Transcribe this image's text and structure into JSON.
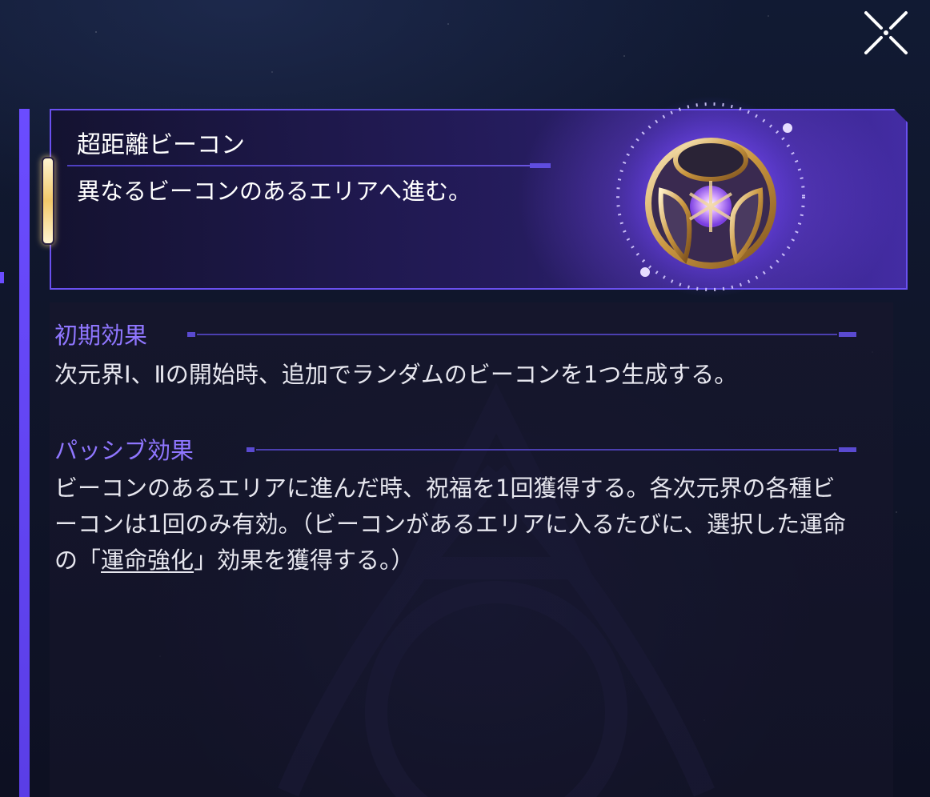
{
  "close_button": {
    "icon": "close-icon"
  },
  "item": {
    "title": "超距離ビーコン",
    "description": "異なるビーコンのあるエリアへ進む。",
    "icon": "beacon-orb-icon"
  },
  "effects": [
    {
      "heading": "初期効果",
      "text": "次元界Ⅰ、Ⅱの開始時、追加でランダムのビーコンを1つ生成する。"
    },
    {
      "heading": "パッシブ効果",
      "text_before_link": "ビーコンのあるエリアに進んだ時、祝福を1回獲得する。各次元界の各種ビーコンは1回のみ有効。（ビーコンがあるエリアに入るたびに、選択した運命の「",
      "link_text": "運命強化",
      "text_after_link": "」効果を獲得する。）"
    }
  ],
  "colors": {
    "accent": "#6b4cff",
    "heading": "#8f76ff",
    "text": "#e6e6ee"
  }
}
